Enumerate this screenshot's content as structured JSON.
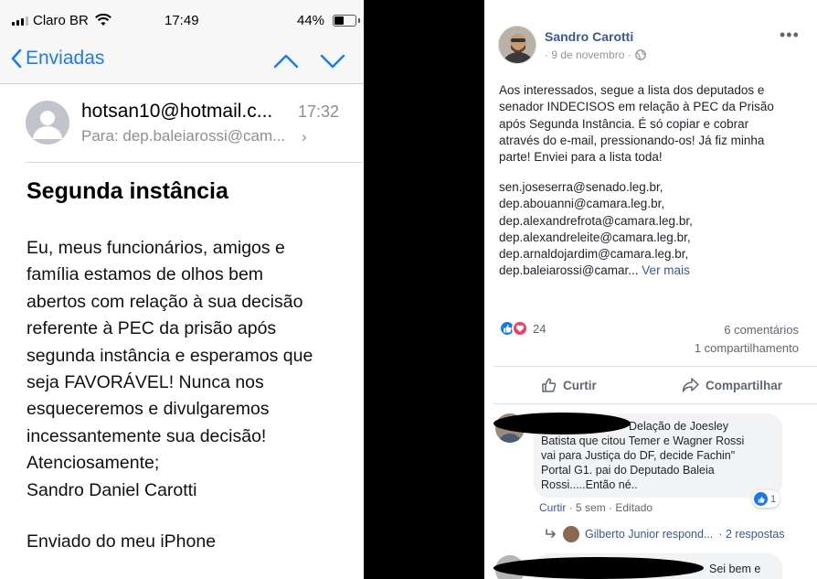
{
  "phone": {
    "status": {
      "carrier": "Claro BR",
      "time": "17:49",
      "battery": "44%",
      "battery_level": 0.44
    },
    "nav": {
      "back_label": "Enviadas"
    },
    "mail": {
      "from": "hotsan10@hotmail.c...",
      "time": "17:32",
      "to_label": "Para:",
      "to_value": "dep.baleiarossi@cam...",
      "subject": "Segunda instância",
      "body_lines": [
        "Eu, meus funcionários, amigos e",
        "família estamos de olhos bem",
        "abertos com relação à sua decisão",
        "referente à PEC da prisão após",
        "segunda instância e esperamos que",
        "seja FAVORÁVEL! Nunca nos",
        "esqueceremos e divulgaremos",
        "incessantemente sua decisão!",
        "Atenciosamente;",
        "Sandro Daniel Carotti"
      ],
      "signature": "Enviado do meu iPhone"
    }
  },
  "post": {
    "author": "Sandro Carotti",
    "date": "· 9 de novembro ·",
    "text_lines": [
      "Aos interessados, segue a lista dos deputados e",
      "senador INDECISOS em relação à PEC da Prisão",
      "após Segunda Instância. É só copiar e cobrar",
      "através do e-mail, pressionando-os! Já fiz minha",
      "parte! Enviei para a lista toda!"
    ],
    "emails": [
      "sen.joseserra@senado.leg.br,",
      "dep.abouanni@camara.leg.br,",
      "dep.alexandrefrota@camara.leg.br,",
      "dep.alexandreleite@camara.leg.br,",
      "dep.arnaldojardim@camara.leg.br,"
    ],
    "last_email": "dep.baleiarossi@camar...",
    "see_more": "Ver mais",
    "reactions_count": "24",
    "comments_count": "6 comentários",
    "shares_count": "1 compartilhamento",
    "like_label": "Curtir",
    "share_label": "Compartilhar",
    "comment1": {
      "lines": [
        "Delação de Joesley",
        "Batista que citou Temer e Wagner Rossi",
        "vai para Justiça do DF, decide Fachin\"",
        "Portal G1. pai do Deputado Baleia",
        "Rossi.....Então né.."
      ],
      "like": "Curtir",
      "time": "· 5 sem · Editado",
      "likes": "1"
    },
    "reply_summary": {
      "name": "Gilberto Junior respond...",
      "count": "· 2 respostas"
    },
    "comment2": {
      "text": "Sei bem e"
    }
  },
  "colors": {
    "ios_blue": "#1a7cf5",
    "fb_blue": "#385898",
    "like_blue": "#1877f2",
    "love_red": "#f33e58"
  }
}
